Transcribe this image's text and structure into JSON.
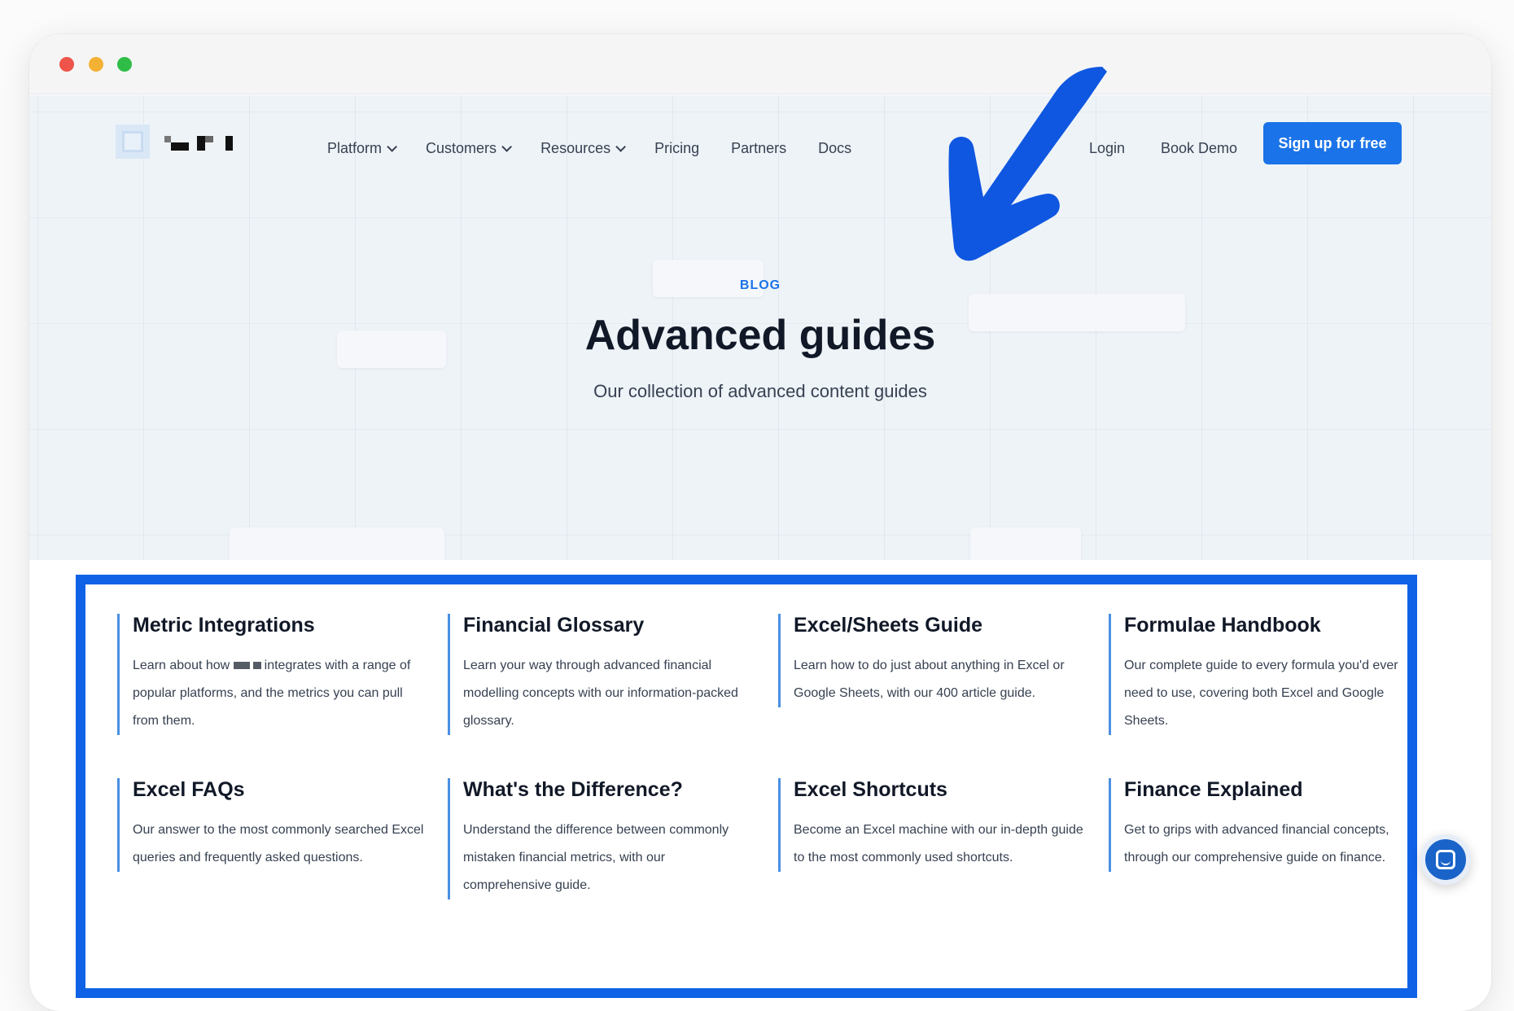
{
  "nav": {
    "items": [
      {
        "label": "Platform",
        "dropdown": true
      },
      {
        "label": "Customers",
        "dropdown": true
      },
      {
        "label": "Resources",
        "dropdown": true
      },
      {
        "label": "Pricing",
        "dropdown": false
      },
      {
        "label": "Partners",
        "dropdown": false
      },
      {
        "label": "Docs",
        "dropdown": false
      }
    ],
    "login_label": "Login",
    "demo_label": "Book Demo",
    "signup_label": "Sign up for free"
  },
  "hero": {
    "eyebrow": "BLOG",
    "title": "Advanced guides",
    "subtitle": "Our collection of advanced content guides"
  },
  "guides": [
    {
      "title": "Metric Integrations",
      "desc_pre": "Learn about how",
      "desc_post": "integrates with a range of popular platforms, and the metrics you can pull from them."
    },
    {
      "title": "Financial Glossary",
      "desc": "Learn your way through advanced financial modelling concepts with our information-packed glossary."
    },
    {
      "title": "Excel/Sheets Guide",
      "desc": "Learn how to do just about anything in Excel or Google Sheets, with our 400 article guide."
    },
    {
      "title": "Formulae Handbook",
      "desc": "Our complete guide to every formula you'd ever need to use, covering both Excel and Google Sheets."
    },
    {
      "title": "Excel FAQs",
      "desc": "Our answer to the most commonly searched Excel queries and frequently asked questions."
    },
    {
      "title": "What's the Difference?",
      "desc": "Understand the difference between commonly mistaken financial metrics, with our comprehensive guide."
    },
    {
      "title": "Excel Shortcuts",
      "desc": "Become an Excel machine with our in-depth guide to the most commonly used shortcuts."
    },
    {
      "title": "Finance Explained",
      "desc": "Get to grips with advanced financial concepts, through our comprehensive guide on finance."
    }
  ],
  "colors": {
    "accent": "#1a73e8",
    "highlight_border": "#0f62e6",
    "annotation_arrow": "#0f57e0"
  },
  "icons": [
    "chevron-down-icon",
    "chat-bubble-icon",
    "annotation-arrow-icon"
  ]
}
